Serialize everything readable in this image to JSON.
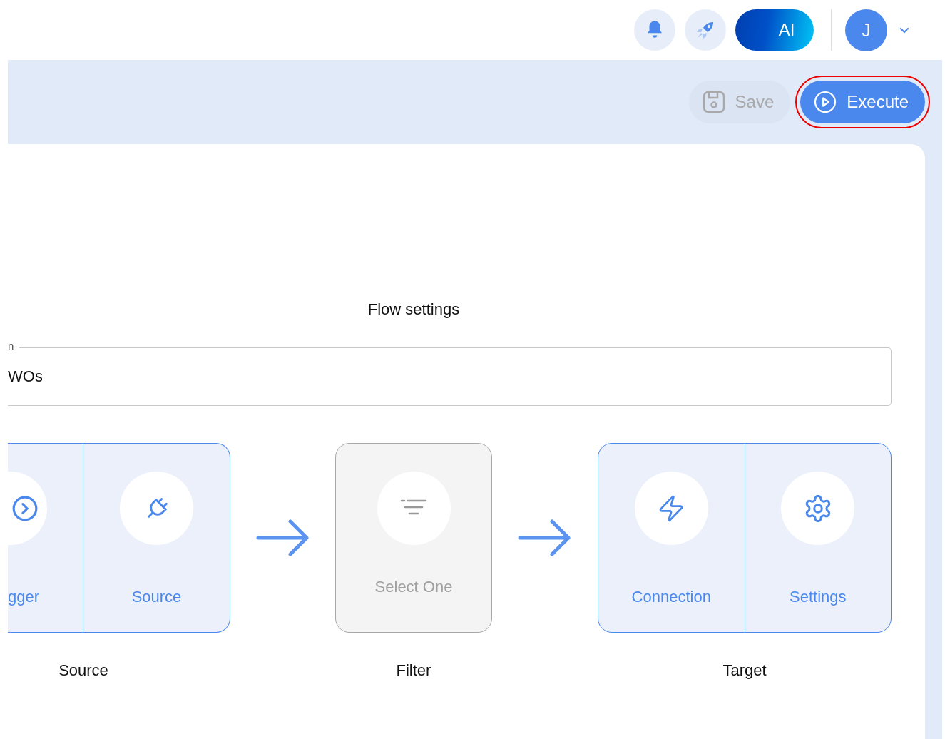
{
  "topbar": {
    "icons": [
      {
        "kind": "bell"
      },
      {
        "kind": "rocket"
      }
    ],
    "ai_button": {
      "label": "AI"
    },
    "avatar": {
      "initial": "J"
    }
  },
  "toolbar": {
    "buttons": [
      {
        "kind": "save",
        "label": "Save",
        "disabled": true,
        "highlighted": false
      },
      {
        "kind": "execute",
        "label": "Execute",
        "disabled": false,
        "highlighted": true
      }
    ]
  },
  "flow_settings": {
    "title": "Flow settings",
    "name_field": {
      "label": "n",
      "value": "WOs"
    },
    "stages": [
      {
        "label": "Source",
        "kind": "configured",
        "steps": [
          {
            "label": "gger",
            "kind": "trigger",
            "clipped": true
          },
          {
            "label": "Source",
            "kind": "plug",
            "clipped": false
          }
        ]
      },
      {
        "label": "Filter",
        "kind": "placeholder",
        "steps": [
          {
            "label": "Select One",
            "kind": "filter",
            "clipped": false
          }
        ]
      },
      {
        "label": "Target",
        "kind": "configured",
        "steps": [
          {
            "label": "Connection",
            "kind": "bolt",
            "clipped": false
          },
          {
            "label": "Settings",
            "kind": "gear",
            "clipped": false
          }
        ]
      }
    ]
  }
}
